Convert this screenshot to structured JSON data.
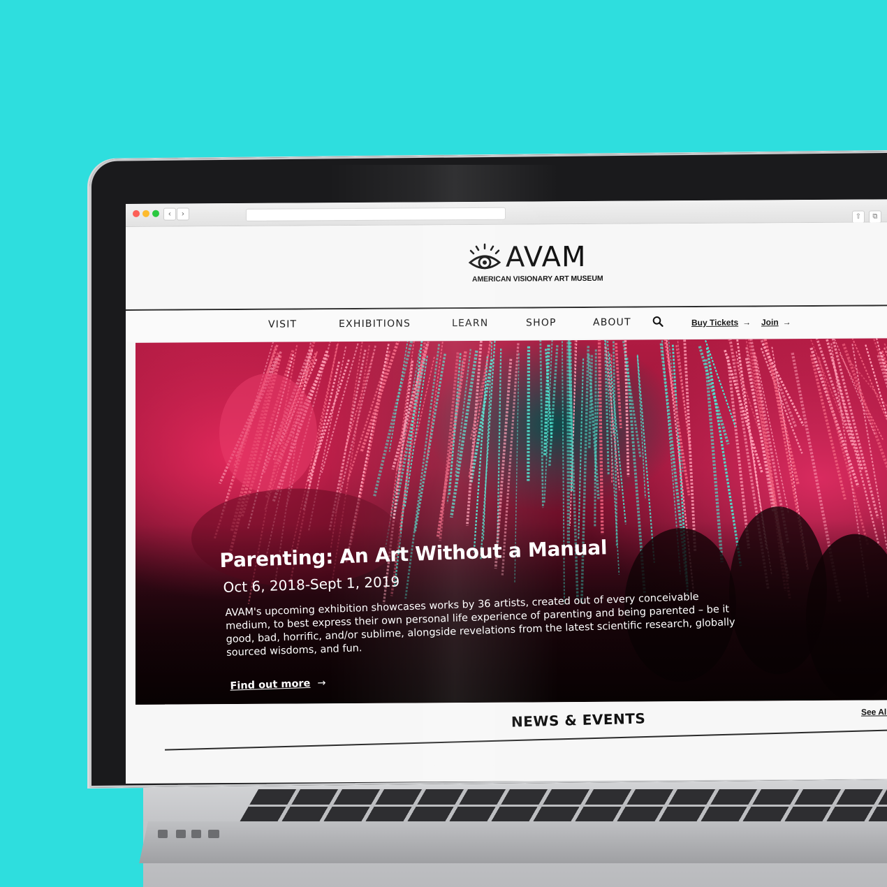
{
  "colors": {
    "background": "#2edede",
    "accent_hero": "#b01b42",
    "text_dark": "#111111",
    "traffic_red": "#fc5f57",
    "traffic_yellow": "#fdbb2e",
    "traffic_green": "#2ac840"
  },
  "browser": {
    "back_glyph": "‹",
    "forward_glyph": "›",
    "share_icon": "share-icon",
    "tabs_icon": "tabs-icon"
  },
  "header": {
    "logo_icon": "eye-icon",
    "logo_text": "AVAM",
    "logo_subtitle": "AMERICAN VISIONARY ART MUSEUM"
  },
  "nav": {
    "items": [
      {
        "label": "VISIT"
      },
      {
        "label": "EXHIBITIONS"
      },
      {
        "label": "LEARN"
      },
      {
        "label": "SHOP"
      },
      {
        "label": "ABOUT"
      }
    ],
    "search_icon": "search-icon",
    "buy_tickets": "Buy Tickets",
    "join": "Join",
    "arrow": "→"
  },
  "hero": {
    "title": "Parenting: An Art Without a Manual",
    "date": "Oct 6, 2018-Sept 1, 2019",
    "body": "AVAM's upcoming exhibition showcases works by 36 artists, created out of every conceivable medium, to best express their own personal life experience of parenting and being parented – be it good, bad, horrific, and/or sublime, alongside revelations from the latest scientific research, globally sourced wisdoms, and fun.",
    "cta": "Find out more",
    "cta_arrow": "→"
  },
  "news": {
    "title": "NEWS & EVENTS",
    "see_all": "See All"
  }
}
